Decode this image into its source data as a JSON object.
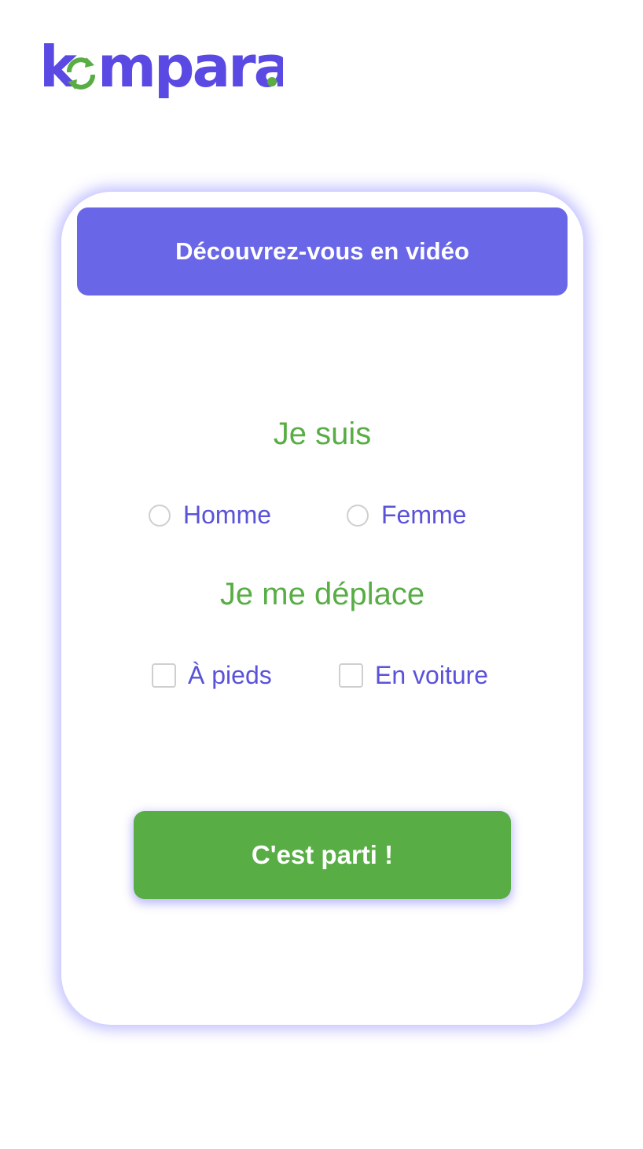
{
  "brand": {
    "logo_text": "kompara",
    "logo_dot": ".",
    "colors": {
      "purple": "#5a4ae3",
      "green": "#58ad45"
    }
  },
  "card": {
    "header_button_label": "Découvrez-vous en vidéo",
    "gender": {
      "title": "Je suis",
      "options": [
        {
          "label": "Homme",
          "checked": false
        },
        {
          "label": "Femme",
          "checked": false
        }
      ]
    },
    "transport": {
      "title": "Je me déplace",
      "options": [
        {
          "label": "À pieds",
          "checked": false
        },
        {
          "label": "En voiture",
          "checked": false
        }
      ]
    },
    "submit_label": "C'est parti !"
  },
  "colors": {
    "header_bg": "#6966e8",
    "option_text": "#5a52d9",
    "title_text": "#58ad45",
    "submit_bg": "#58ad45",
    "card_glow": "#7873ff"
  }
}
